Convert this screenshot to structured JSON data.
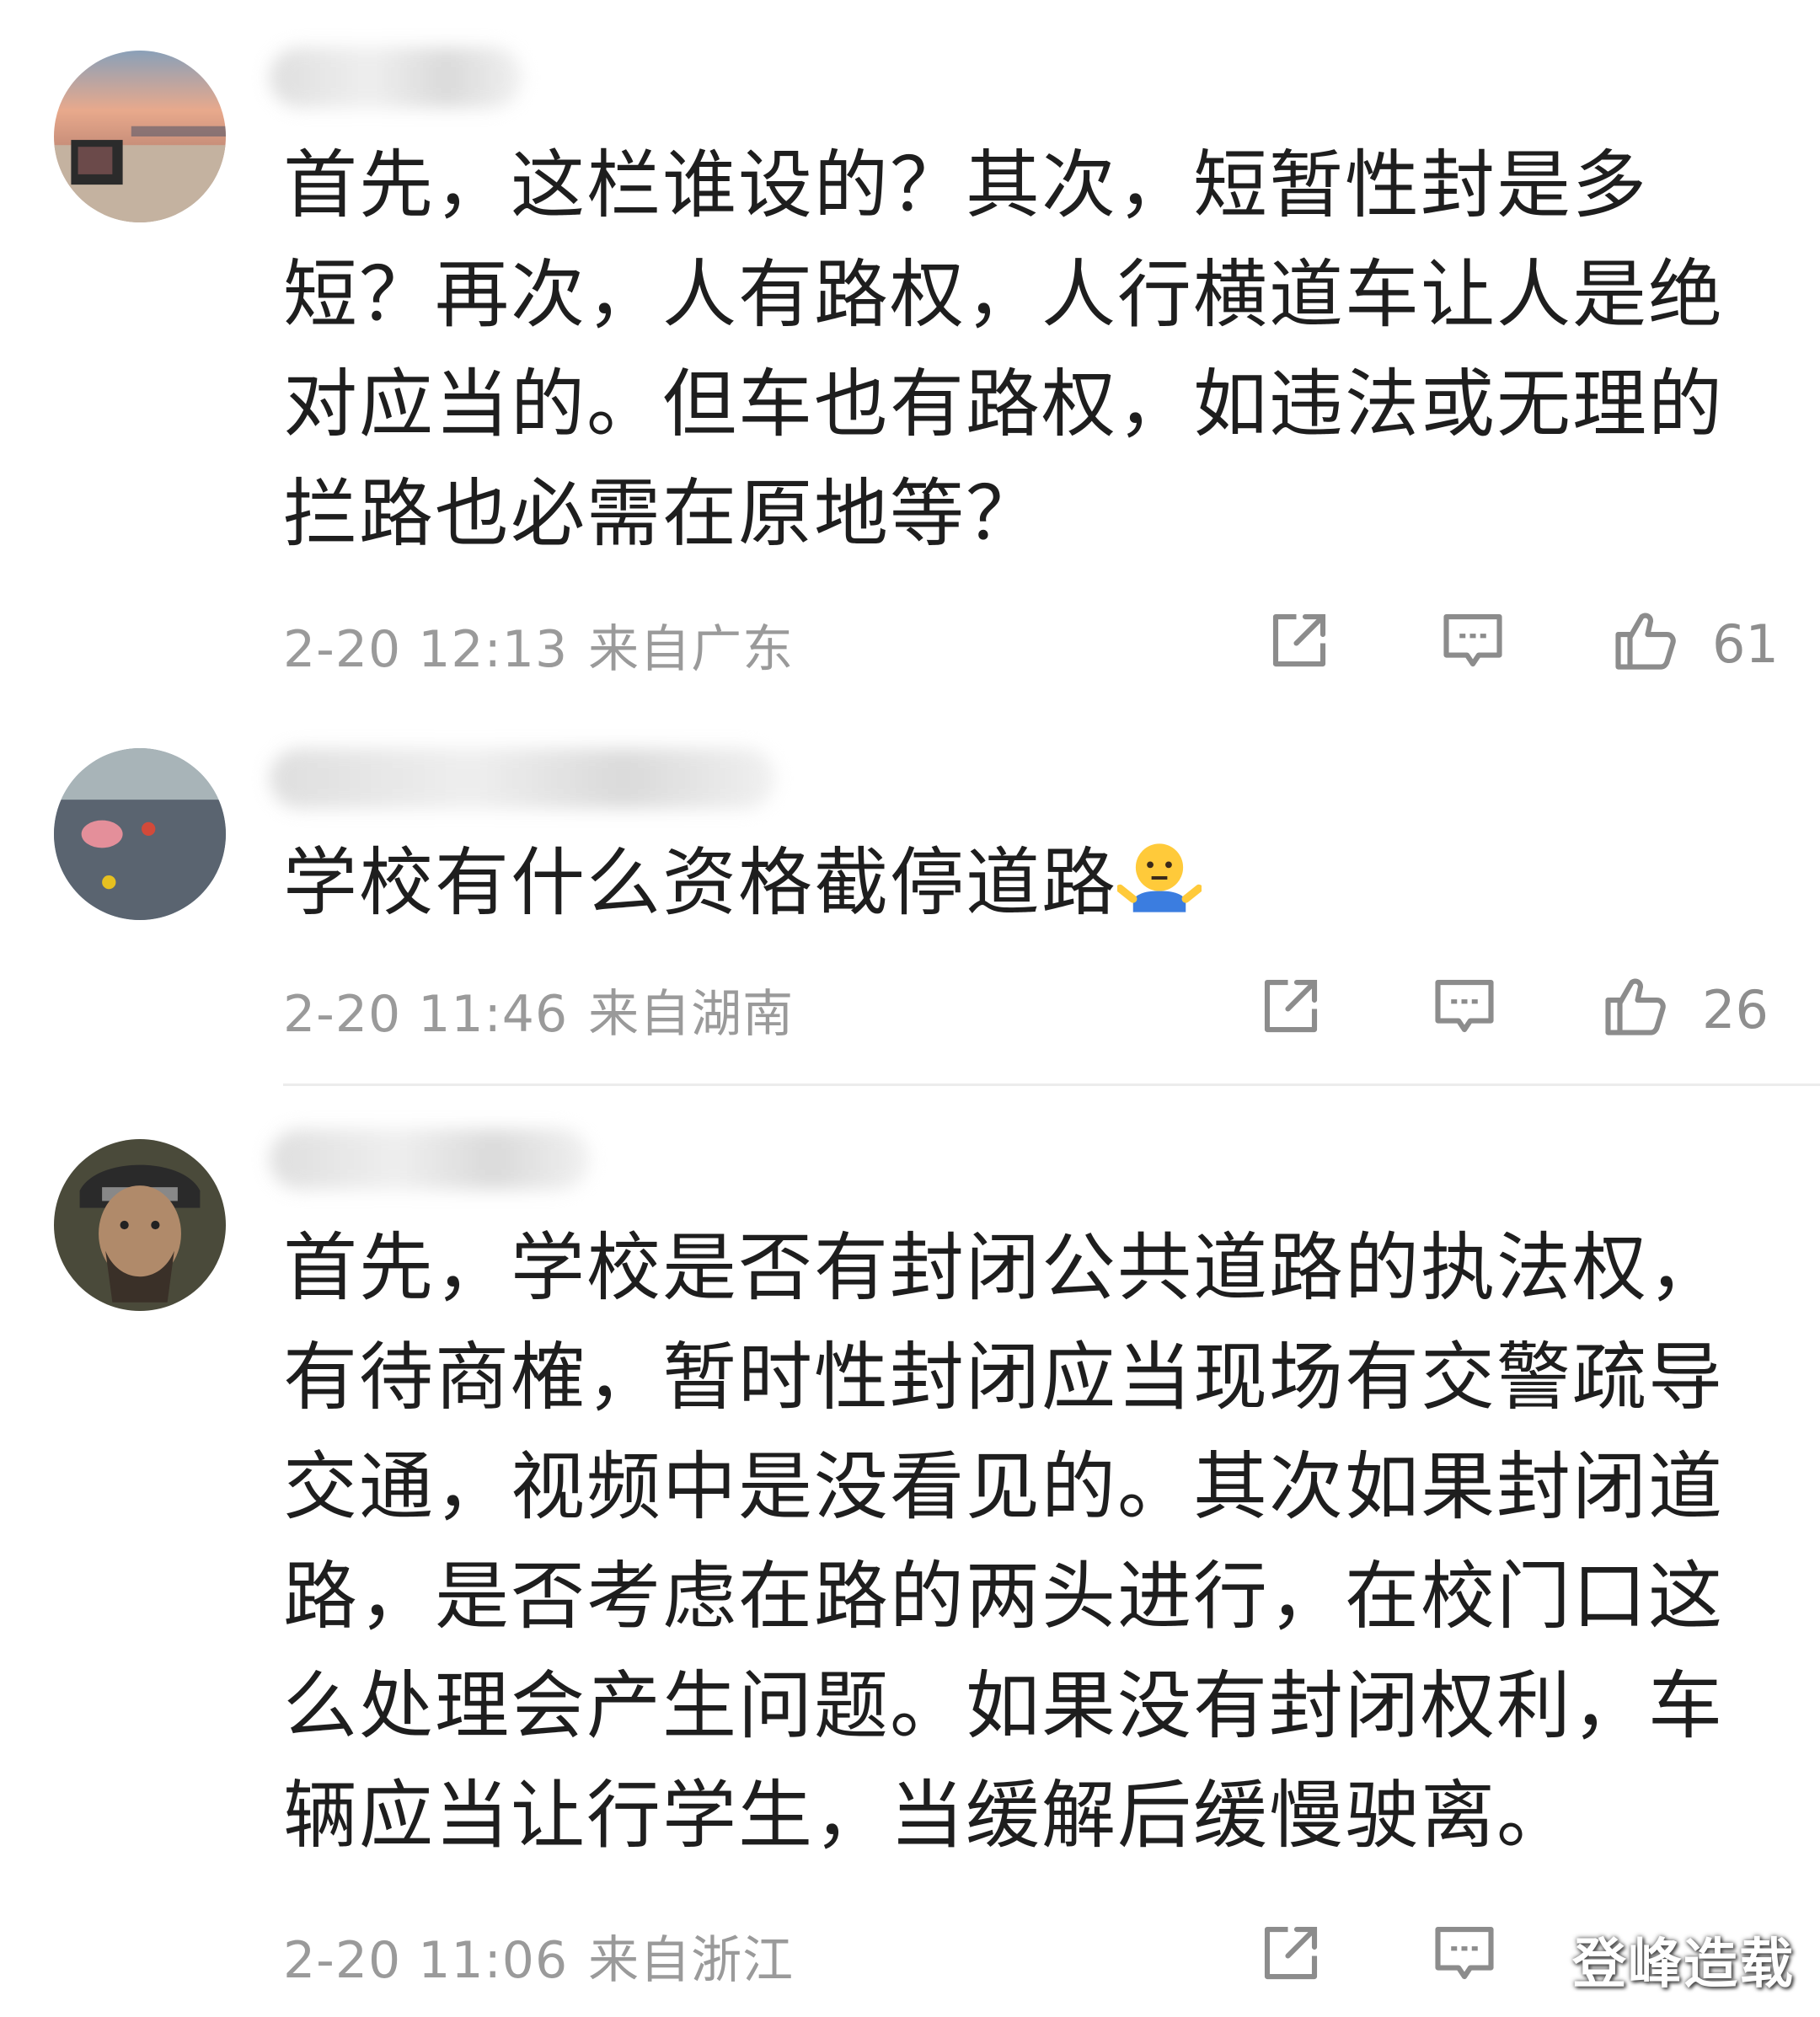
{
  "comments": [
    {
      "text": "首先，这栏谁设的？其次，短暂性封是多短？再次，人有路权，人行横道车让人是绝对应当的。但车也有路权，如违法或无理的拦路也必需在原地等？",
      "date": "2-20 12:13",
      "location": "来自广东",
      "likes": "61"
    },
    {
      "text": "学校有什么资格截停道路",
      "emoji": "shrugging-person-emoji",
      "date": "2-20 11:46",
      "location": "来自湖南",
      "likes": "26"
    },
    {
      "text": "首先，学校是否有封闭公共道路的执法权，有待商榷，暂时性封闭应当现场有交警疏导交通，视频中是没看见的。其次如果封闭道路，是否考虑在路的两头进行，在校门口这么处理会产生问题。如果没有封闭权利，车辆应当让行学生，当缓解后缓慢驶离。",
      "date": "2-20 11:06",
      "location": "来自浙江"
    }
  ],
  "watermark": "登峰造载",
  "icons": [
    "share-icon",
    "comment-icon",
    "like-icon"
  ],
  "colors": {
    "text": "#1e1e1e",
    "meta": "#9a9a9a",
    "icon": "#8c8c8c",
    "divider": "#ececec"
  }
}
